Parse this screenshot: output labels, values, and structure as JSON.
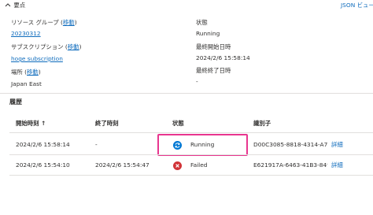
{
  "essentials": {
    "toggle_label": "要点",
    "json_view_label": "JSON ビュー",
    "resource_group": {
      "label": "リソース グループ",
      "move_label": "移動",
      "value": "20230312"
    },
    "subscription": {
      "label": "サブスクリプション",
      "move_label": "移動",
      "value": "hoge subscription"
    },
    "location": {
      "label": "場所",
      "move_label": "移動",
      "value": "Japan East"
    },
    "state": {
      "label": "状態",
      "value": "Running"
    },
    "last_start": {
      "label": "最終開始日時",
      "value": "2024/2/6 15:58:14"
    },
    "last_end": {
      "label": "最終終了日時",
      "value": "-"
    }
  },
  "history": {
    "title": "履歴",
    "columns": {
      "start": "開始時刻 ↑",
      "end": "終了時刻",
      "status": "状態",
      "id": "識別子"
    },
    "rows": [
      {
        "start": "2024/2/6 15:58:14",
        "end": "-",
        "status": "Running",
        "status_type": "running",
        "id": "D00C3085-8818-4314-A77A",
        "detail": "詳細"
      },
      {
        "start": "2024/2/6 15:54:10",
        "end": "2024/2/6 15:54:47",
        "status": "Failed",
        "status_type": "failed",
        "id": "E621917A-6463-41B3-8491",
        "detail": "詳細"
      }
    ]
  },
  "colors": {
    "link": "#0f6cbd",
    "running": "#0078d4",
    "failed": "#d13438",
    "highlight": "#e8368f"
  }
}
